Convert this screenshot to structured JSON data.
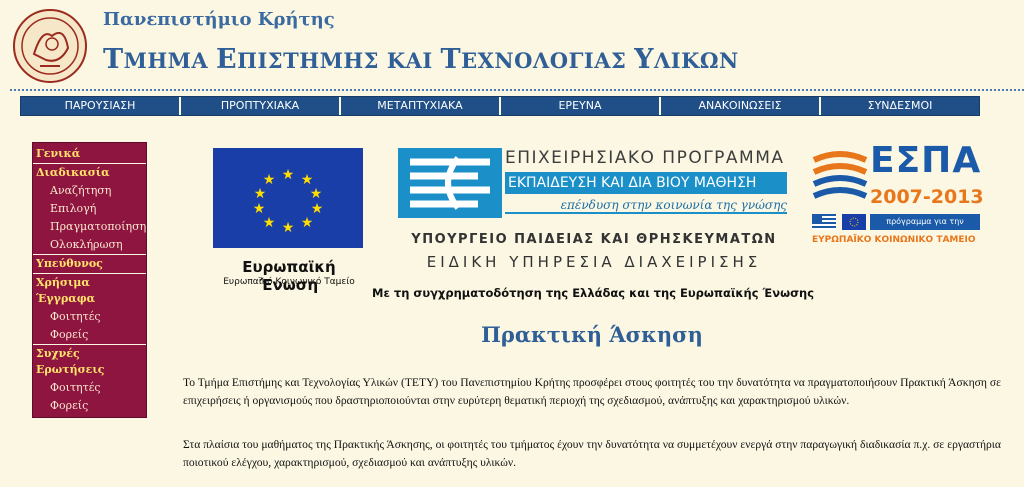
{
  "header": {
    "university": "Πανεπιστήμιο Κρήτης",
    "department": "Τμημα Επιστημης και Τεχνολογιας Υλικων",
    "department_parts": [
      {
        "big": "Τ",
        "small": "ΜΗΜΑ "
      },
      {
        "big": "Ε",
        "small": "ΠΙΣΤΗΜΗΣ ΚΑΙ "
      },
      {
        "big": "Τ",
        "small": "ΕΧΝΟΛΟΓΙΑΣ "
      },
      {
        "big": "Υ",
        "small": "ΛΙΚΩΝ"
      }
    ]
  },
  "topnav": {
    "items": [
      "ΠΑΡΟΥΣΙΑΣΗ",
      "ΠΡΟΠΤΥΧΙΑΚΑ",
      "ΜΕΤΑΠΤΥΧΙΑΚΑ",
      "ΕΡΕΥΝΑ",
      "ΑΝΑΚΟΙΝΩΣΕΙΣ",
      "ΣΥΝΔΕΣΜΟΙ"
    ]
  },
  "sidemenu": {
    "groups": [
      {
        "head": "Γενικά",
        "items": []
      },
      {
        "head": "Διαδικασία",
        "items": [
          "Αναζήτηση",
          "Επιλογή",
          "Πραγματοποίηση",
          "Ολοκλήρωση"
        ]
      },
      {
        "head": "Υπεύθυνος",
        "items": []
      },
      {
        "head": "Χρήσιμα Έγγραφα",
        "items": [
          "Φοιτητές",
          "Φορείς"
        ]
      },
      {
        "head": "Συχνές Ερωτήσεις",
        "items": [
          "Φοιτητές",
          "Φορείς"
        ]
      }
    ]
  },
  "banner": {
    "eu_title": "Ευρωπαϊκή Ένωση",
    "eu_subtitle": "Ευρωπαϊκό Κοινωνικό Ταμείο",
    "program_top": "ΕΠΙΧΕΙΡΗΣΙΑΚΟ ΠΡΟΓΡΑΜΜΑ",
    "program_mid": "ΕΚΠΑΙΔΕΥΣΗ ΚΑΙ ΔΙΑ ΒΙΟΥ ΜΑΘΗΣΗ",
    "program_slogan": "επένδυση στην κοινωνία της γνώσης",
    "ministry": "ΥΠΟΥΡΓΕΙΟ ΠΑΙΔΕΙΑΣ ΚΑΙ ΘΡΗΣΚΕΥΜΑΤΩΝ",
    "special_service": "ΕΙΔΙΚΗ ΥΠΗΡΕΣΙΑ ΔΙΑΧΕΙΡΙΣΗΣ",
    "cofund": "Με τη συγχρηματοδότηση της Ελλάδας και της Ευρωπαϊκής Ένωσης",
    "espa_title": "ΕΣΠΑ",
    "espa_years": "2007-2013",
    "espa_tag": "πρόγραμμα για την ανάπτυξη",
    "espa_fund": "ΕΥΡΩΠΑΪΚΟ ΚΟΙΝΩΝΙΚΟ ΤΑΜΕΙΟ"
  },
  "content": {
    "title": "Πρακτική Άσκηση",
    "paragraph1": "Το Τμήμα Επιστήμης και Τεχνολογίας Υλικών (ΤΕΤΥ) του Πανεπιστημίου Κρήτης προσφέρει στους φοιτητές του την δυνατότητα να πραγματοποιήσουν Πρακτική Άσκηση σε επιχειρήσεις ή οργανισμούς που δραστηριοποιούνται στην ευρύτερη θεματική περιοχή της σχεδιασμού, ανάπτυξης και χαρακτηρισμού υλικών.",
    "paragraph2": "Στα πλαίσια του μαθήματος της Πρακτικής Άσκησης, οι φοιτητές του τμήματος έχουν την δυνατότητα να συμμετέχουν ενεργά στην παραγωγική διαδικασία π.χ. σε εργαστήρια ποιοτικού ελέγχου, χαρακτηρισμού, σχεδιασμού και ανάπτυξης υλικών."
  },
  "icons": {
    "university_logo": "university-seal-icon",
    "eu_flag": "eu-flag-icon",
    "program_logo": "education-program-logo-icon",
    "espa_logo": "espa-logo-icon",
    "flags": "greece-eu-flags-icon"
  },
  "colors": {
    "background": "#fbf7e3",
    "nav": "#1f4f86",
    "sidemenu": "#8e1540",
    "sidemenu_head": "#ffe36b",
    "title": "#2f5f96",
    "espa_blue": "#1a5aa8",
    "espa_orange": "#e8761b"
  }
}
